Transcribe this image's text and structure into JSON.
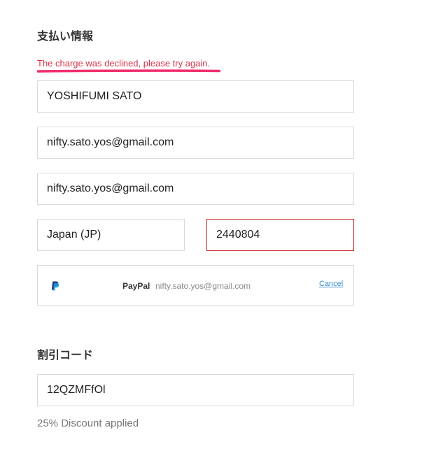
{
  "payment": {
    "title": "支払い情報",
    "error": "The charge was declined, please try again.",
    "name_value": "YOSHIFUMI SATO",
    "email_value": "nifty.sato.yos@gmail.com",
    "email_confirm_value": "nifty.sato.yos@gmail.com",
    "country_value": "Japan (JP)",
    "postal_value": "2440804"
  },
  "paypal": {
    "icon": "paypal-icon",
    "label": "PayPal",
    "email": "nifty.sato.yos@gmail.com",
    "cancel_label": "Cancel"
  },
  "discount": {
    "title": "割引コード",
    "code_value": "12QZMFfOl",
    "note": "25% Discount applied"
  },
  "colors": {
    "error_text": "#d9334a",
    "error_underline": "#f0306e",
    "error_border": "#c62828",
    "link": "#3c8ccf",
    "paypal_dark_blue": "#253b80",
    "paypal_light_blue": "#179bd7"
  }
}
